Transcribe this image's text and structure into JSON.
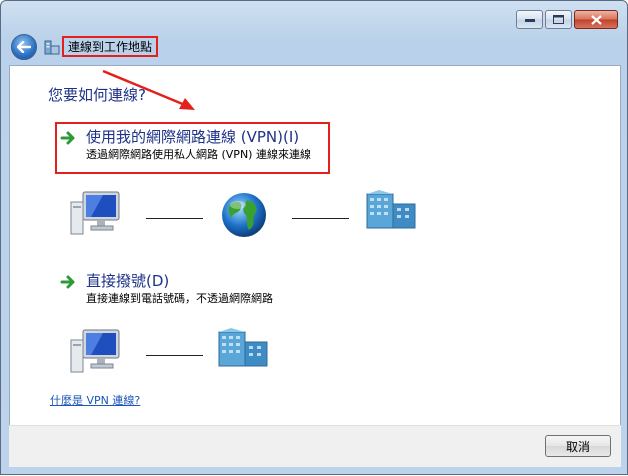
{
  "window": {
    "title": "連線到工作地點"
  },
  "main": {
    "question": "您要如何連線?",
    "options": [
      {
        "title": "使用我的網際網路連線 (VPN)(I)",
        "description": "透過網際網路使用私人網路 (VPN) 連線來連線"
      },
      {
        "title": "直接撥號(D)",
        "description": "直接連線到電話號碼，不透過網際網路"
      }
    ],
    "help_link": "什麼是 VPN 連線?"
  },
  "footer": {
    "cancel_label": "取消"
  },
  "colors": {
    "heading": "#1e3287",
    "highlight": "#e3201b",
    "link": "#1a56b8"
  },
  "icons": [
    "back-arrow-icon",
    "network-folder-icon",
    "green-arrow-icon",
    "computer-icon",
    "globe-icon",
    "office-building-icon",
    "minimize-icon",
    "maximize-icon",
    "close-icon"
  ]
}
